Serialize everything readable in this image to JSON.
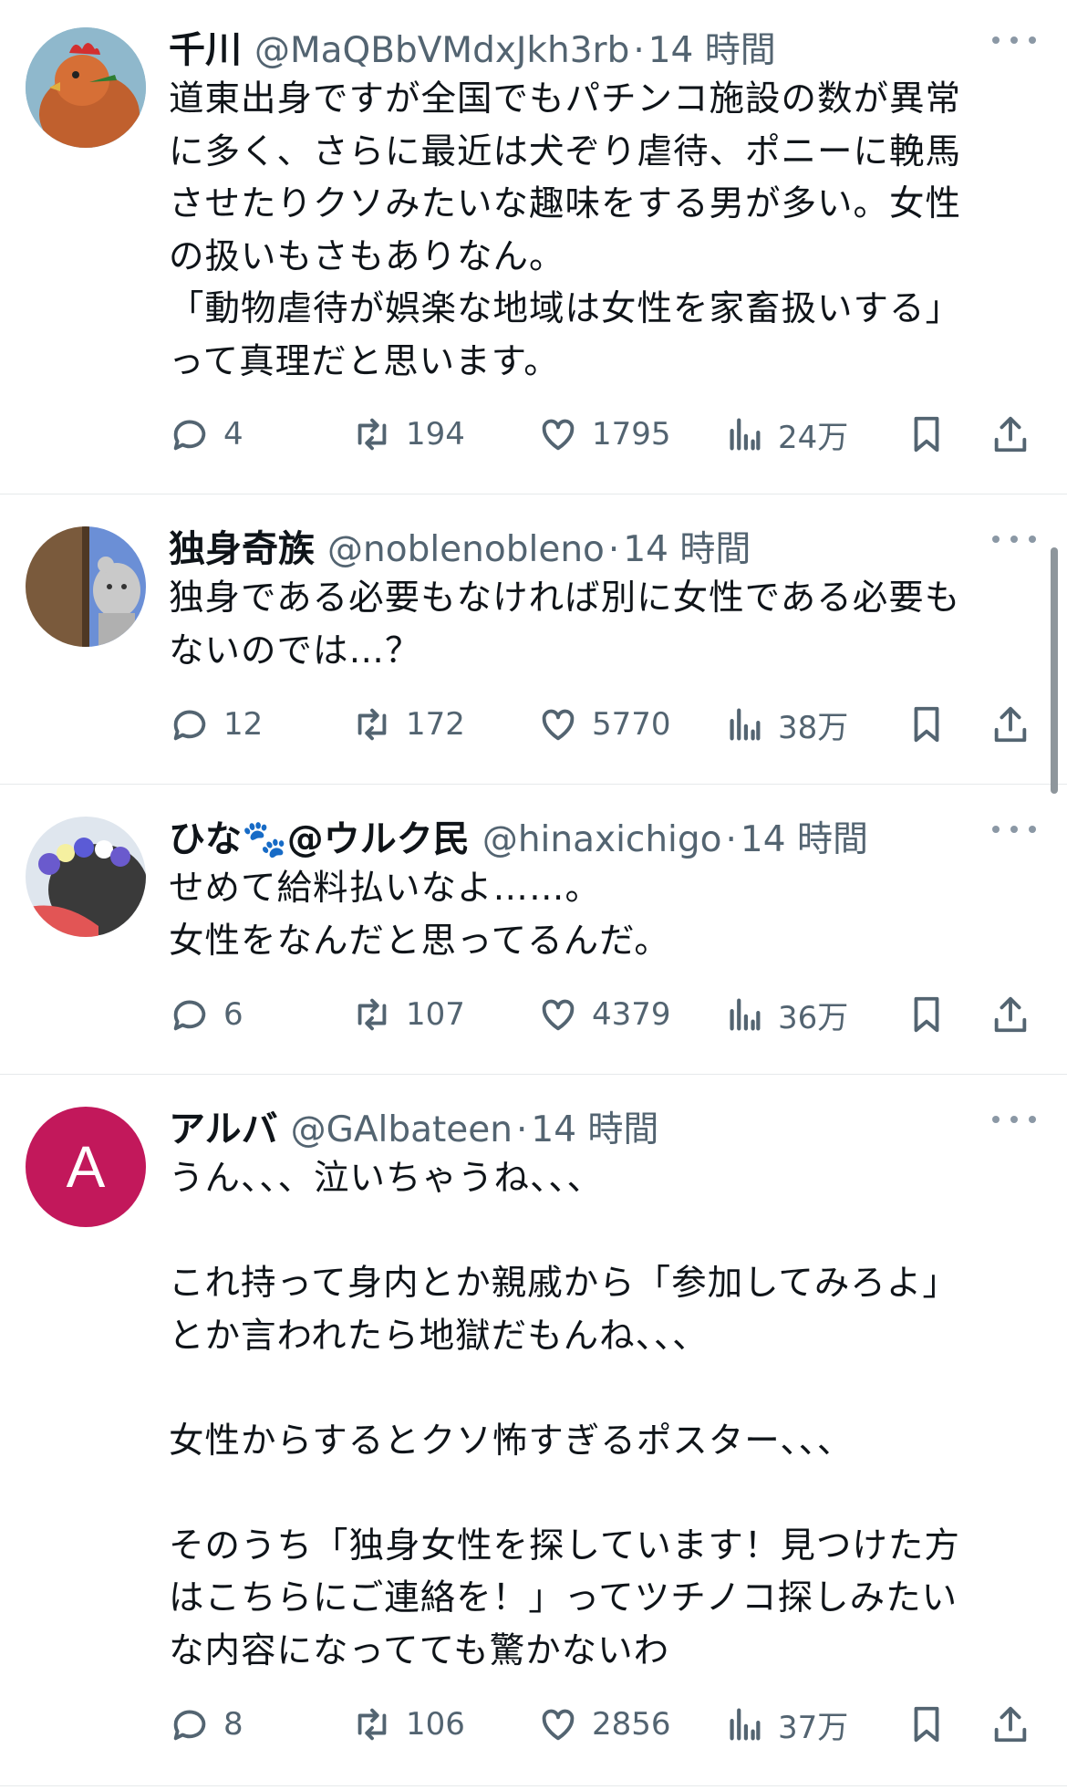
{
  "tweets": [
    {
      "name": "千川",
      "handle": "@MaQBbVMdxJkh3rb",
      "dot": "·",
      "time": "14 時間",
      "text": "道東出身ですが全国でもパチンコ施設の数が異常\nに多く、さらに最近は犬ぞり虐待、ポニーに輓馬\nさせたりクソみたいな趣味をする男が多い。女性\nの扱いもさもありなん。\n「動物虐待が娯楽な地域は女性を家畜扱いする」\nって真理だと思います。",
      "replies": "4",
      "retweets": "194",
      "likes": "1795",
      "views": "24万",
      "avatar_color": "#8fb8cc"
    },
    {
      "name": "独身奇族",
      "handle": "@noblenobleno",
      "dot": "·",
      "time": "14 時間",
      "text": "独身である必要もなければ別に女性である必要も\nないのでは…？",
      "replies": "12",
      "retweets": "172",
      "likes": "5770",
      "views": "38万",
      "avatar_color": "#7a5a3c"
    },
    {
      "name": "ひな🐾@ウルク民",
      "handle": "@hinaxichigo",
      "dot": "·",
      "time": "14 時間",
      "text": "せめて給料払いなよ……。\n女性をなんだと思ってるんだ。",
      "replies": "6",
      "retweets": "107",
      "likes": "4379",
      "views": "36万",
      "avatar_color": "#4a4a4a"
    },
    {
      "name": "アルバ",
      "handle": "@GAlbateen",
      "dot": "·",
      "time": "14 時間",
      "text": "うん、、、泣いちゃうね、、、\n\nこれ持って身内とか親戚から「参加してみろよ」\nとか言われたら地獄だもんね、、、\n\n女性からするとクソ怖すぎるポスター、、、\n\nそのうち「独身女性を探しています！見つけた方\nはこちらにご連絡を！」ってツチノコ探しみたい\nな内容になってても驚かないわ",
      "replies": "8",
      "retweets": "106",
      "likes": "2856",
      "views": "37万",
      "avatar_letter": "A",
      "avatar_color": "#c2185b"
    }
  ],
  "icons": {
    "reply": "reply-icon",
    "retweet": "retweet-icon",
    "like": "heart-icon",
    "views": "views-icon",
    "bookmark": "bookmark-icon",
    "share": "share-icon",
    "more": "more-icon"
  },
  "colors": {
    "text": "#0f1419",
    "secondary": "#536471",
    "divider": "#e6e9eb"
  }
}
